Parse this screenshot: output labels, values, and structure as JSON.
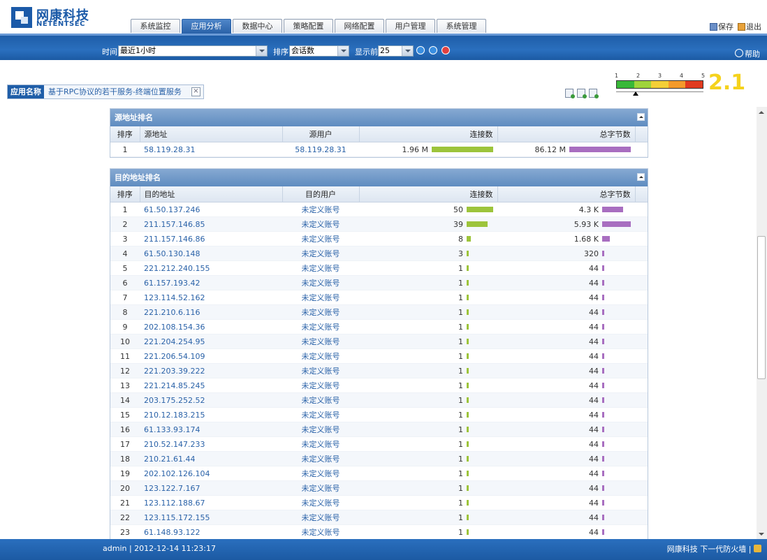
{
  "brand": {
    "name_cn": "网康科技",
    "name_en": "NETENTSEC"
  },
  "tabs": [
    {
      "label": "系统监控",
      "w": 69
    },
    {
      "label": "应用分析",
      "w": 69,
      "active": true
    },
    {
      "label": "数据中心",
      "w": 69
    },
    {
      "label": "策略配置",
      "w": 69
    },
    {
      "label": "网络配置",
      "w": 69
    },
    {
      "label": "用户管理",
      "w": 69
    },
    {
      "label": "系统管理",
      "w": 69
    }
  ],
  "header": {
    "save_label": "保存",
    "logout_label": "退出"
  },
  "toolbar": {
    "time_label": "时间",
    "time_value": "最近1小时",
    "sort_label": "排序",
    "sort_value": "会话数",
    "top_label": "显示前",
    "top_value": "25",
    "help_label": "帮助"
  },
  "app": {
    "label": "应用名称",
    "value": "基于RPC协议的若干服务-终端位置服务",
    "clear": "×"
  },
  "scale": {
    "ticks": [
      "1",
      "2",
      "3",
      "4",
      "5"
    ],
    "score": "2.1",
    "level_fraction": 0.22,
    "colors": [
      "#38b838",
      "#9fd43a",
      "#f3cf37",
      "#f39a2a",
      "#e03a1e"
    ]
  },
  "colors": {
    "accent": "#1f5ea8",
    "bar_connections": "#9dc43b",
    "bar_bytes": "#a86ec0"
  },
  "source_panel": {
    "title": "源地址排名",
    "headers": {
      "rank": "排序",
      "addr": "源地址",
      "user": "源用户",
      "conn": "连接数",
      "bytes": "总字节数"
    },
    "rows": [
      {
        "rank": "1",
        "addr": "58.119.28.31",
        "user": "58.119.28.31",
        "conn": "1.96 M",
        "bytes": "86.12 M",
        "conn_frac": 1.0,
        "bytes_frac": 1.0
      }
    ]
  },
  "dest_panel": {
    "title": "目的地址排名",
    "headers": {
      "rank": "排序",
      "addr": "目的地址",
      "user": "目的用户",
      "conn": "连接数",
      "bytes": "总字节数"
    },
    "rows": [
      {
        "rank": "1",
        "addr": "61.50.137.246",
        "user": "未定义账号",
        "conn": "50",
        "bytes": "4.3 K",
        "conn_frac": 1.0,
        "bytes_frac": 0.73
      },
      {
        "rank": "2",
        "addr": "211.157.146.85",
        "user": "未定义账号",
        "conn": "39",
        "bytes": "5.93 K",
        "conn_frac": 0.78,
        "bytes_frac": 1.0
      },
      {
        "rank": "3",
        "addr": "211.157.146.86",
        "user": "未定义账号",
        "conn": "8",
        "bytes": "1.68 K",
        "conn_frac": 0.16,
        "bytes_frac": 0.28
      },
      {
        "rank": "4",
        "addr": "61.50.130.148",
        "user": "未定义账号",
        "conn": "3",
        "bytes": "320",
        "conn_frac": 0.06,
        "bytes_frac": 0.05
      },
      {
        "rank": "5",
        "addr": "221.212.240.155",
        "user": "未定义账号",
        "conn": "1",
        "bytes": "44",
        "conn_frac": 0.02,
        "bytes_frac": 0.01
      },
      {
        "rank": "6",
        "addr": "61.157.193.42",
        "user": "未定义账号",
        "conn": "1",
        "bytes": "44",
        "conn_frac": 0.02,
        "bytes_frac": 0.01
      },
      {
        "rank": "7",
        "addr": "123.114.52.162",
        "user": "未定义账号",
        "conn": "1",
        "bytes": "44",
        "conn_frac": 0.02,
        "bytes_frac": 0.01
      },
      {
        "rank": "8",
        "addr": "221.210.6.116",
        "user": "未定义账号",
        "conn": "1",
        "bytes": "44",
        "conn_frac": 0.02,
        "bytes_frac": 0.01
      },
      {
        "rank": "9",
        "addr": "202.108.154.36",
        "user": "未定义账号",
        "conn": "1",
        "bytes": "44",
        "conn_frac": 0.02,
        "bytes_frac": 0.01
      },
      {
        "rank": "10",
        "addr": "221.204.254.95",
        "user": "未定义账号",
        "conn": "1",
        "bytes": "44",
        "conn_frac": 0.02,
        "bytes_frac": 0.01
      },
      {
        "rank": "11",
        "addr": "221.206.54.109",
        "user": "未定义账号",
        "conn": "1",
        "bytes": "44",
        "conn_frac": 0.02,
        "bytes_frac": 0.01
      },
      {
        "rank": "12",
        "addr": "221.203.39.222",
        "user": "未定义账号",
        "conn": "1",
        "bytes": "44",
        "conn_frac": 0.02,
        "bytes_frac": 0.01
      },
      {
        "rank": "13",
        "addr": "221.214.85.245",
        "user": "未定义账号",
        "conn": "1",
        "bytes": "44",
        "conn_frac": 0.02,
        "bytes_frac": 0.01
      },
      {
        "rank": "14",
        "addr": "203.175.252.52",
        "user": "未定义账号",
        "conn": "1",
        "bytes": "44",
        "conn_frac": 0.02,
        "bytes_frac": 0.01
      },
      {
        "rank": "15",
        "addr": "210.12.183.215",
        "user": "未定义账号",
        "conn": "1",
        "bytes": "44",
        "conn_frac": 0.02,
        "bytes_frac": 0.01
      },
      {
        "rank": "16",
        "addr": "61.133.93.174",
        "user": "未定义账号",
        "conn": "1",
        "bytes": "44",
        "conn_frac": 0.02,
        "bytes_frac": 0.01
      },
      {
        "rank": "17",
        "addr": "210.52.147.233",
        "user": "未定义账号",
        "conn": "1",
        "bytes": "44",
        "conn_frac": 0.02,
        "bytes_frac": 0.01
      },
      {
        "rank": "18",
        "addr": "210.21.61.44",
        "user": "未定义账号",
        "conn": "1",
        "bytes": "44",
        "conn_frac": 0.02,
        "bytes_frac": 0.01
      },
      {
        "rank": "19",
        "addr": "202.102.126.104",
        "user": "未定义账号",
        "conn": "1",
        "bytes": "44",
        "conn_frac": 0.02,
        "bytes_frac": 0.01
      },
      {
        "rank": "20",
        "addr": "123.122.7.167",
        "user": "未定义账号",
        "conn": "1",
        "bytes": "44",
        "conn_frac": 0.02,
        "bytes_frac": 0.01
      },
      {
        "rank": "21",
        "addr": "123.112.188.67",
        "user": "未定义账号",
        "conn": "1",
        "bytes": "44",
        "conn_frac": 0.02,
        "bytes_frac": 0.01
      },
      {
        "rank": "22",
        "addr": "123.115.172.155",
        "user": "未定义账号",
        "conn": "1",
        "bytes": "44",
        "conn_frac": 0.02,
        "bytes_frac": 0.01
      },
      {
        "rank": "23",
        "addr": "61.148.93.122",
        "user": "未定义账号",
        "conn": "1",
        "bytes": "44",
        "conn_frac": 0.02,
        "bytes_frac": 0.01
      }
    ]
  },
  "footer": {
    "status": "admin | 2012-12-14 11:23:17",
    "slogan": "网康科技 下一代防火墙 |"
  }
}
